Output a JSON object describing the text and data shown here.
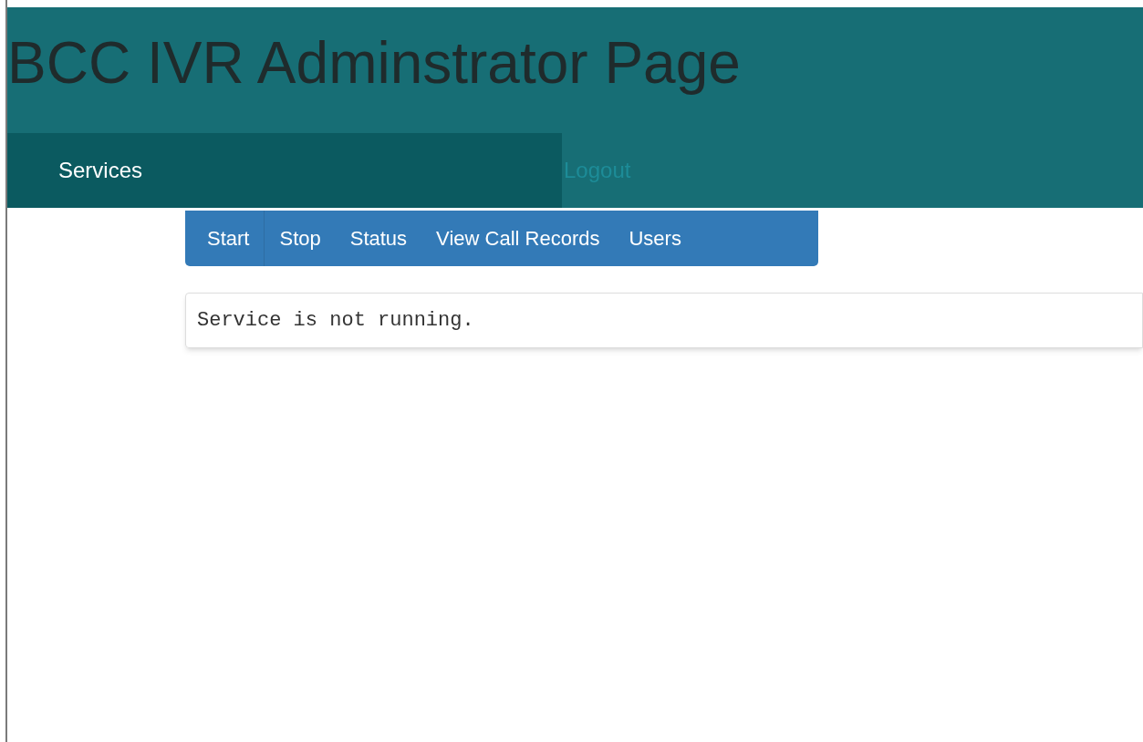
{
  "header": {
    "title": "BCC IVR Adminstrator Page"
  },
  "nav": [
    {
      "label": "Services",
      "selected": true
    },
    {
      "label": "Logout",
      "selected": false
    }
  ],
  "subnav": [
    "Start",
    "Stop",
    "Status",
    "View Call Records",
    "Users"
  ],
  "output": {
    "text": "Service is not running."
  }
}
